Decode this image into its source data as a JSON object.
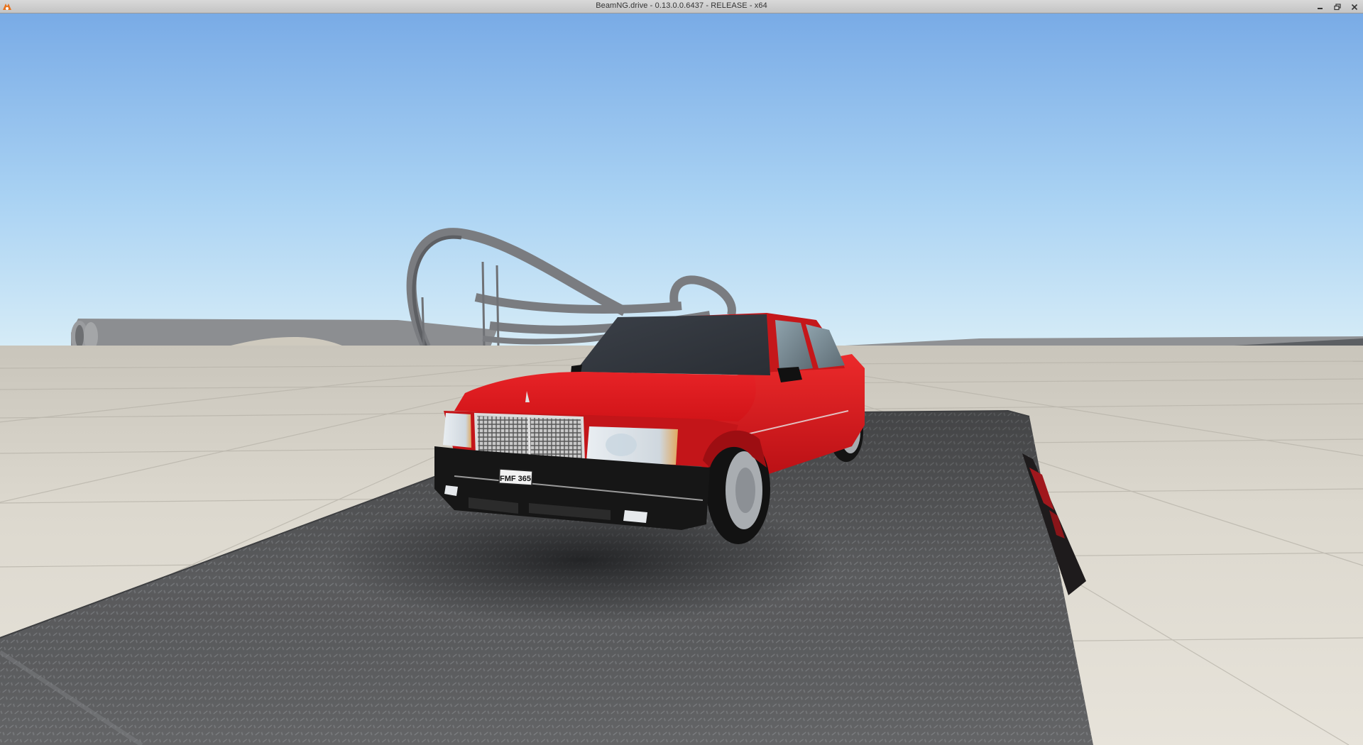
{
  "window": {
    "title": "BeamNG.drive - 0.13.0.0.6437 - RELEASE - x64",
    "controls": [
      {
        "name": "minimize-button",
        "icon": "minimize-icon"
      },
      {
        "name": "restore-button",
        "icon": "restore-icon"
      },
      {
        "name": "close-button",
        "icon": "close-icon"
      }
    ]
  },
  "scene": {
    "description_icons": [
      "app-logo-icon"
    ],
    "vehicle": {
      "color": "#d8161a",
      "plate_text": "FMF 365"
    },
    "colors": {
      "sky_top": "#7aaee8",
      "sky_horizon": "#cfe8f6",
      "ground": "#d7d2c6",
      "platform": "#5b5c5e"
    }
  }
}
